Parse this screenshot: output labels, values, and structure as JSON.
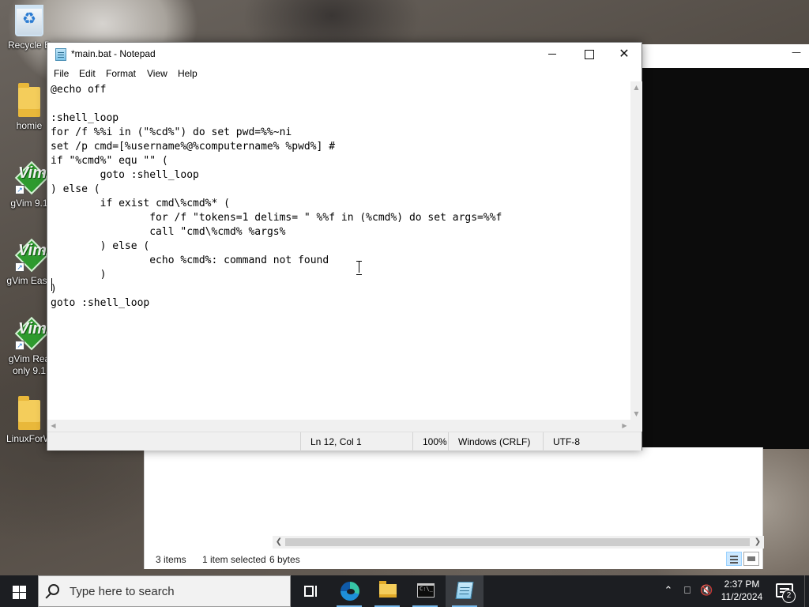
{
  "desktop": {
    "icons": [
      {
        "label": "Recycle B",
        "icon": "recycle-bin-icon"
      },
      {
        "label": "homie",
        "icon": "folder-icon"
      },
      {
        "label": "gVim 9.1",
        "icon": "gvim-icon"
      },
      {
        "label": "gVim Easy",
        "icon": "gvim-icon"
      },
      {
        "label": "gVim Rea\nonly 9.1",
        "icon": "gvim-icon"
      },
      {
        "label": "LinuxForW",
        "icon": "folder-icon"
      }
    ]
  },
  "notepad": {
    "title": "*main.bat - Notepad",
    "menu": [
      "File",
      "Edit",
      "Format",
      "View",
      "Help"
    ],
    "content": "@echo off\n\n:shell_loop\nfor /f %%i in (\"%cd%\") do set pwd=%%~ni\nset /p cmd=[%username%@%computername% %pwd%] #\nif \"%cmd%\" equ \"\" (\n\tgoto :shell_loop\n) else (\n\tif exist cmd\\%cmd%* (\n\t\tfor /f \"tokens=1 delims= \" %%f in (%cmd%) do set args=%%f\n\t\tcall \"cmd\\%cmd% %args%\n\t) else (\n\t\techo %cmd%: command not found\n\t)\n)\ngoto :shell_loop",
    "status": {
      "position": "Ln 12, Col 1",
      "zoom": "100%",
      "line_ending": "Windows (CRLF)",
      "encoding": "UTF-8"
    }
  },
  "explorer": {
    "status": {
      "items": "3 items",
      "selected": "1 item selected",
      "size": "6 bytes"
    }
  },
  "taskbar": {
    "search_placeholder": "Type here to search",
    "apps": [
      "task-view-icon",
      "edge-icon",
      "file-explorer-icon",
      "command-prompt-icon",
      "notepad-icon"
    ],
    "clock_time": "2:37 PM",
    "clock_date": "11/2/2024",
    "notification_count": "2"
  },
  "colors": {
    "taskbar": "#1c1e22",
    "accent": "#76b9ed"
  }
}
